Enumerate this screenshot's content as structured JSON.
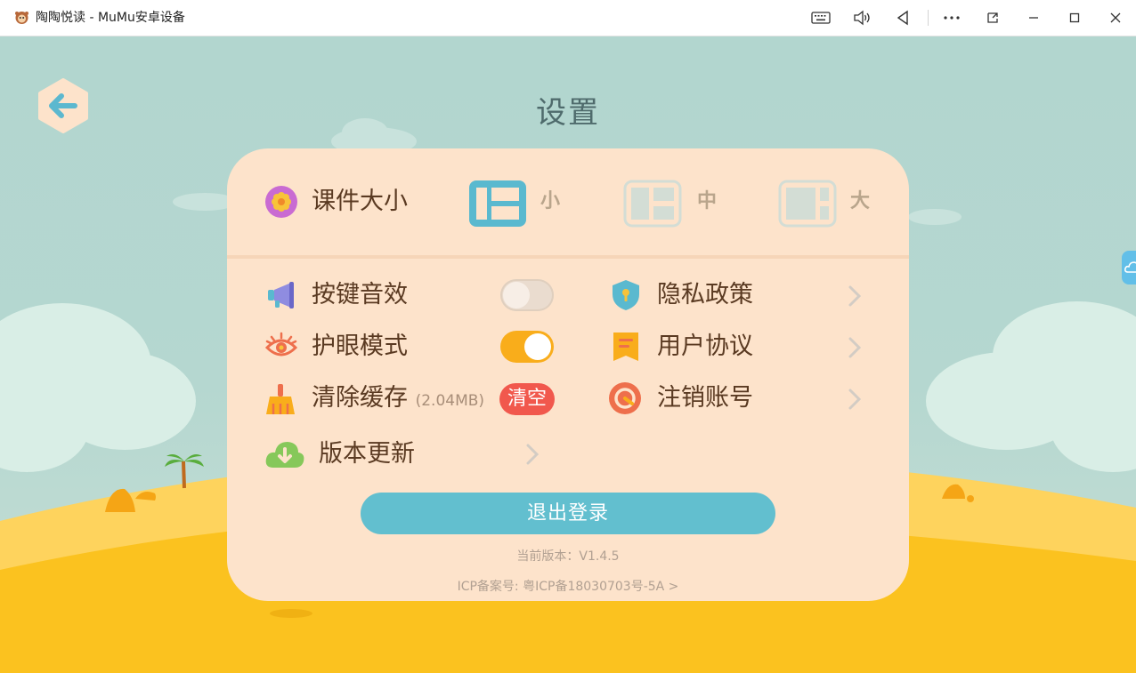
{
  "window": {
    "title": "陶陶悦读 - MuMu安卓设备",
    "controls": [
      "keyboard-icon",
      "volume-icon",
      "back-triangle-icon",
      "more-icon",
      "detach-icon",
      "minimize-icon",
      "maximize-icon",
      "close-icon"
    ]
  },
  "page": {
    "title": "设置"
  },
  "courseware_size": {
    "label": "课件大小",
    "options": [
      {
        "label": "小",
        "selected": true
      },
      {
        "label": "中",
        "selected": false
      },
      {
        "label": "大",
        "selected": false
      }
    ]
  },
  "settings": {
    "key_sound": {
      "label": "按键音效",
      "on": false
    },
    "eye_mode": {
      "label": "护眼模式",
      "on": true
    },
    "clear_cache": {
      "label": "清除缓存",
      "size": "(2.04MB)",
      "button": "清空"
    },
    "version_update": {
      "label": "版本更新"
    },
    "privacy": {
      "label": "隐私政策"
    },
    "user_agreement": {
      "label": "用户协议"
    },
    "cancel_account": {
      "label": "注销账号"
    }
  },
  "logout_label": "退出登录",
  "version_text": "当前版本：V1.4.5",
  "icp_text": "ICP备案号: 粤ICP备18030703号-5A >",
  "colors": {
    "accent": "#62bfcf",
    "toggle_on": "#f9ad1b",
    "toggle_off": "#eadccf",
    "clear_button": "#f1584d",
    "panel": "#fde3cb",
    "sand": "#fbc21f"
  }
}
